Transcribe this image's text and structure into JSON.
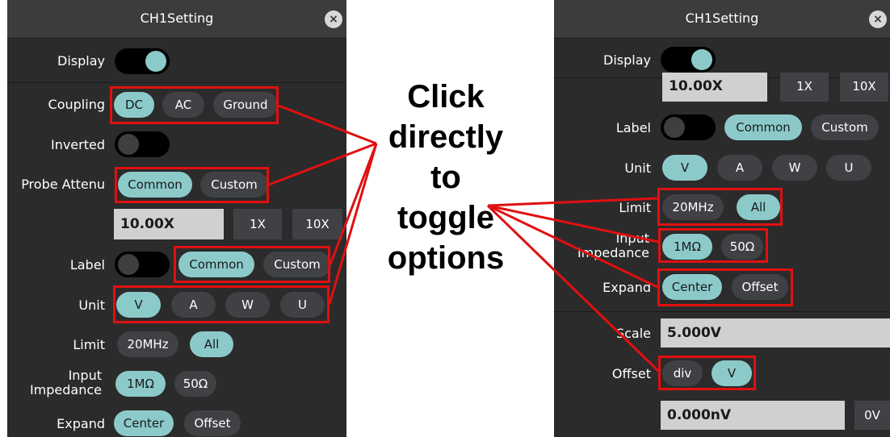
{
  "left_panel": {
    "title": "CH1Setting",
    "close": "×",
    "display_label": "Display",
    "coupling_label": "Coupling",
    "coupling_options": [
      "DC",
      "AC",
      "Ground"
    ],
    "inverted_label": "Inverted",
    "probe_label": "Probe Attenu",
    "probe_options": [
      "Common",
      "Custom"
    ],
    "probe_value": "10.00X",
    "probe_btn_1x": "1X",
    "probe_btn_10x": "10X",
    "label_label": "Label",
    "label_options": [
      "Common",
      "Custom"
    ],
    "unit_label": "Unit",
    "unit_options": [
      "V",
      "A",
      "W",
      "U"
    ],
    "limit_label": "Limit",
    "limit_options": [
      "20MHz",
      "All"
    ],
    "impedance_label_1": "Input",
    "impedance_label_2": "Impedance",
    "impedance_options": [
      "1MΩ",
      "50Ω"
    ],
    "expand_label": "Expand",
    "expand_options": [
      "Center",
      "Offset"
    ]
  },
  "right_panel": {
    "title": "CH1Setting",
    "close": "×",
    "display_label": "Display",
    "probe_value": "10.00X",
    "probe_btn_1x": "1X",
    "probe_btn_10x": "10X",
    "label_label": "Label",
    "label_options": [
      "Common",
      "Custom"
    ],
    "unit_label": "Unit",
    "unit_options": [
      "V",
      "A",
      "W",
      "U"
    ],
    "limit_label": "Limit",
    "limit_options": [
      "20MHz",
      "All"
    ],
    "impedance_label_1": "Input",
    "impedance_label_2": "Impedance",
    "impedance_options": [
      "1MΩ",
      "50Ω"
    ],
    "expand_label": "Expand",
    "expand_options": [
      "Center",
      "Offset"
    ],
    "scale_label": "Scale",
    "scale_value": "5.000V",
    "offset_label": "Offset",
    "offset_options": [
      "div",
      "V"
    ],
    "offset_value": "0.000nV",
    "offset_btn_0v": "0V"
  },
  "callout": {
    "line1": "Click",
    "line2": "directly",
    "line3": "to",
    "line4": "toggle",
    "line5": "options"
  },
  "colors": {
    "panel_bg": "#2b2b2c",
    "selected": "#8ccaca",
    "unselected": "#3f4144",
    "highlight": "#e01010"
  }
}
